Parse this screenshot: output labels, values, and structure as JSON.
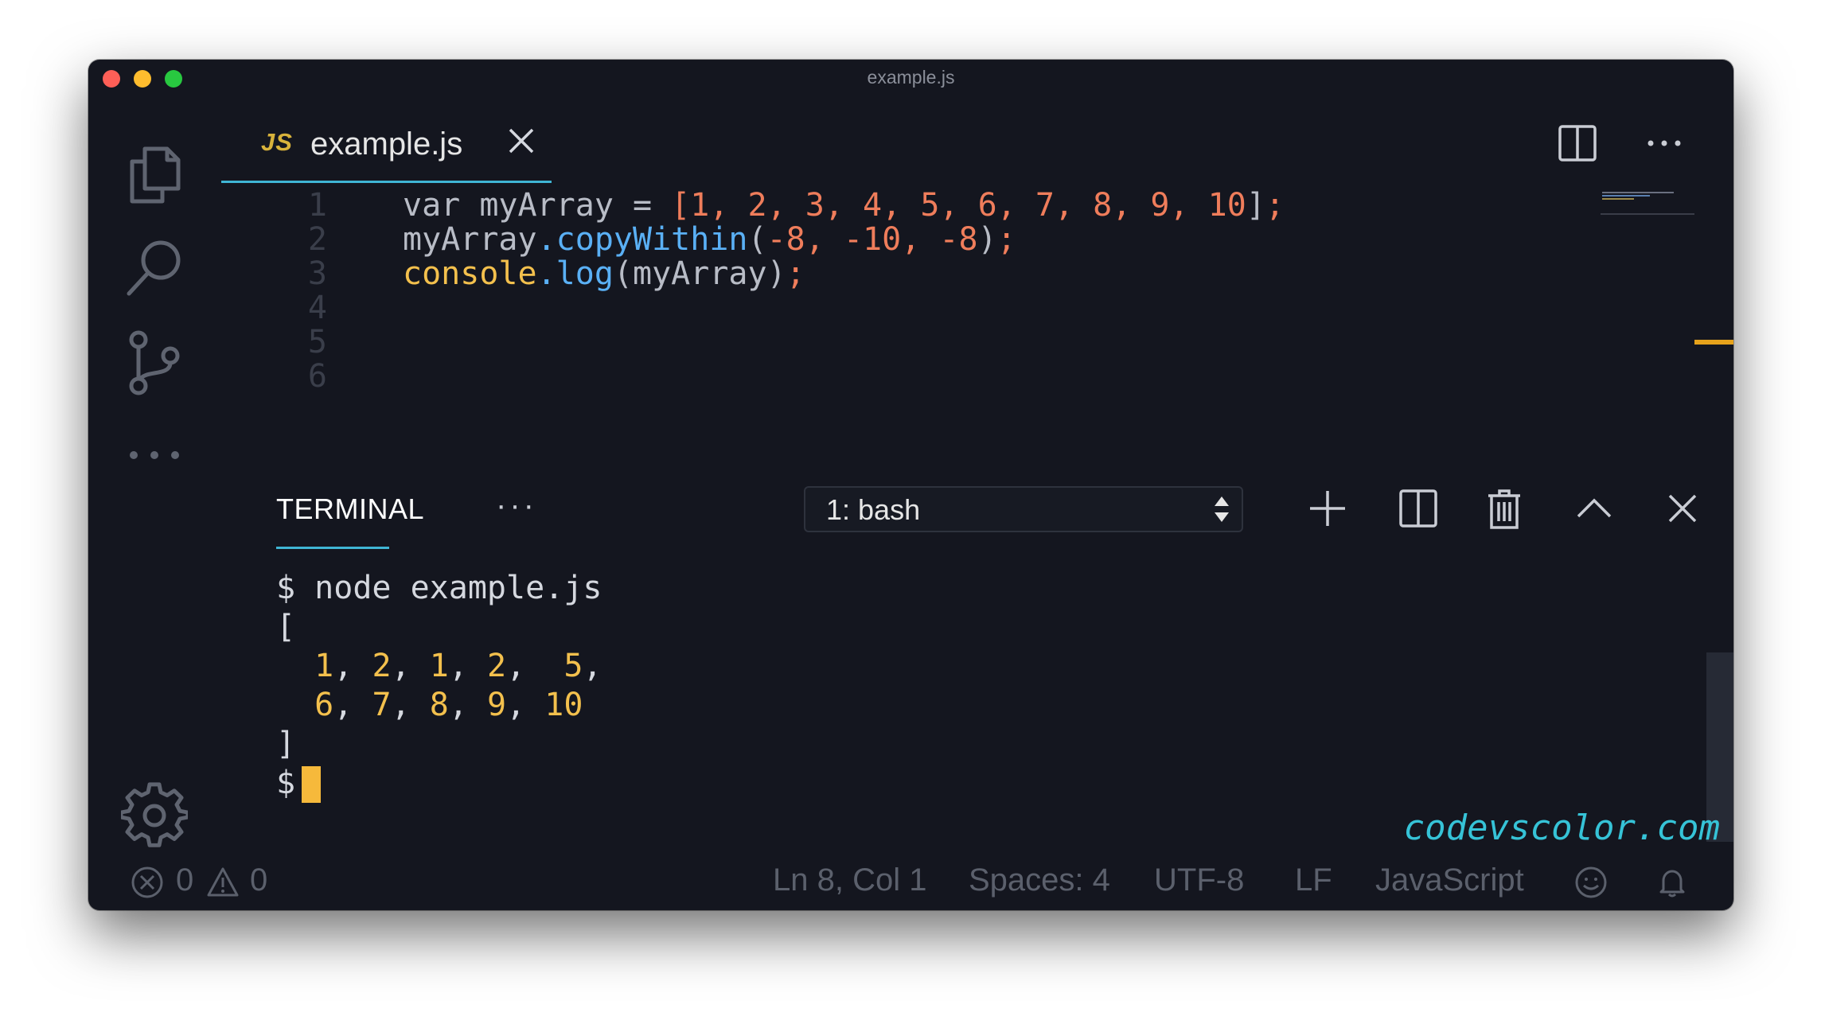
{
  "window": {
    "title": "example.js"
  },
  "activity_bar": {
    "items": [
      {
        "name": "explorer",
        "icon": "files-icon"
      },
      {
        "name": "search",
        "icon": "search-icon"
      },
      {
        "name": "source-control",
        "icon": "git-branch-icon"
      },
      {
        "name": "more",
        "icon": "ellipsis-icon"
      }
    ],
    "bottom_icon": "gear-icon"
  },
  "editor": {
    "tab": {
      "badge": "JS",
      "filename": "example.js"
    },
    "actions": [
      "split-editor-icon",
      "more-actions-icon"
    ],
    "line_numbers": [
      "1",
      "2",
      "3",
      "4",
      "5",
      "6"
    ],
    "lines": [
      [
        {
          "t": "var myArray = ",
          "c": "plain"
        },
        {
          "t": "[",
          "c": "pun"
        },
        {
          "t": "1",
          "c": "num"
        },
        {
          "t": ", ",
          "c": "pun"
        },
        {
          "t": "2",
          "c": "num"
        },
        {
          "t": ", ",
          "c": "pun"
        },
        {
          "t": "3",
          "c": "num"
        },
        {
          "t": ", ",
          "c": "pun"
        },
        {
          "t": "4",
          "c": "num"
        },
        {
          "t": ", ",
          "c": "pun"
        },
        {
          "t": "5",
          "c": "num"
        },
        {
          "t": ", ",
          "c": "pun"
        },
        {
          "t": "6",
          "c": "num"
        },
        {
          "t": ", ",
          "c": "pun"
        },
        {
          "t": "7",
          "c": "num"
        },
        {
          "t": ", ",
          "c": "pun"
        },
        {
          "t": "8",
          "c": "num"
        },
        {
          "t": ", ",
          "c": "pun"
        },
        {
          "t": "9",
          "c": "num"
        },
        {
          "t": ", ",
          "c": "pun"
        },
        {
          "t": "10",
          "c": "num"
        },
        {
          "t": "]",
          "c": "plain"
        },
        {
          "t": ";",
          "c": "pun"
        }
      ],
      [
        {
          "t": "myArray",
          "c": "plain"
        },
        {
          "t": ".",
          "c": "fn"
        },
        {
          "t": "copyWithin",
          "c": "fn"
        },
        {
          "t": "(",
          "c": "plain"
        },
        {
          "t": "-8",
          "c": "num"
        },
        {
          "t": ", ",
          "c": "pun"
        },
        {
          "t": "-10",
          "c": "num"
        },
        {
          "t": ", ",
          "c": "pun"
        },
        {
          "t": "-8",
          "c": "num"
        },
        {
          "t": ")",
          "c": "plain"
        },
        {
          "t": ";",
          "c": "pun"
        }
      ],
      [
        {
          "t": "console",
          "c": "obj"
        },
        {
          "t": ".",
          "c": "fn"
        },
        {
          "t": "log",
          "c": "fn"
        },
        {
          "t": "(myArray)",
          "c": "plain"
        },
        {
          "t": ";",
          "c": "pun"
        }
      ]
    ]
  },
  "panel": {
    "tab_label": "TERMINAL",
    "more_label": "···",
    "terminal_select": "1: bash",
    "actions": [
      "plus-icon",
      "split-terminal-icon",
      "trash-icon",
      "chevron-up-icon",
      "close-icon"
    ],
    "output": [
      {
        "prefix": "$ ",
        "text": "node example.js",
        "style": "plain"
      },
      {
        "prefix": "",
        "text": "[",
        "style": "plain"
      },
      {
        "prefix": "  ",
        "text": "1, 2, 1, 2,  5,",
        "style": "numbers"
      },
      {
        "prefix": "  ",
        "text": "6, 7, 8, 9, 10",
        "style": "numbers"
      },
      {
        "prefix": "",
        "text": "]",
        "style": "plain"
      }
    ],
    "prompt": "$"
  },
  "watermark": "codevscolor.com",
  "status_bar": {
    "errors": "0",
    "warnings": "0",
    "position": "Ln 8, Col 1",
    "spaces": "Spaces: 4",
    "encoding": "UTF-8",
    "eol": "LF",
    "language": "JavaScript"
  },
  "colors": {
    "background": "#14161f",
    "accent": "#3fb5d4",
    "number": "#ef7d5b",
    "function": "#5ab0f5",
    "object": "#f3c04d",
    "cursor": "#f6b93b"
  }
}
